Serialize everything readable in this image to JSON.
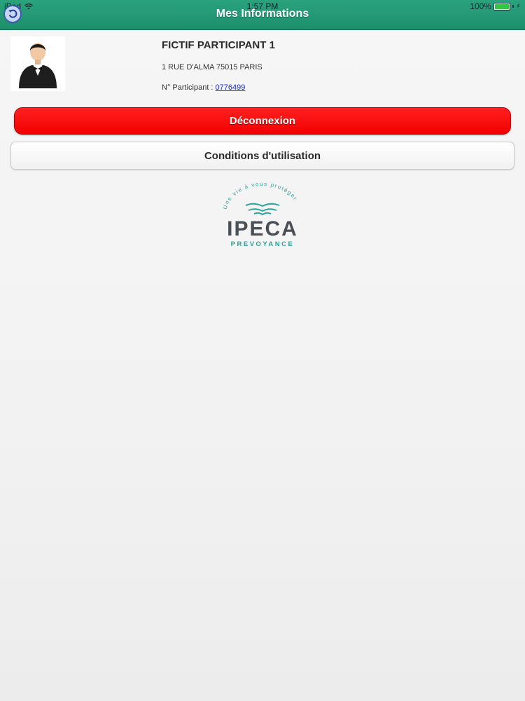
{
  "status_bar": {
    "device": "iPad",
    "time": "1:57 PM",
    "battery_label": "100%",
    "battery_level": 1.0,
    "battery_color": "#35c443"
  },
  "header": {
    "title": "Mes Informations",
    "back_icon": "back-arrow-icon",
    "bar_color": "#1f9470"
  },
  "profile": {
    "avatar_icon": "person-in-suit-icon",
    "name": "FICTIF PARTICIPANT 1",
    "address": "1 RUE D'ALMA 75015 PARIS",
    "participant_label": "N° Participant : ",
    "participant_number": "0776499"
  },
  "actions": {
    "logout_label": "Déconnexion",
    "logout_color": "#ff0a0a",
    "terms_label": "Conditions d'utilisation"
  },
  "logo": {
    "slogan": "Une vie à vous protéger",
    "brand": "IPECA",
    "subtitle": "PREVOYANCE",
    "teal": "#2aa39a",
    "dark": "#4a4f56"
  }
}
